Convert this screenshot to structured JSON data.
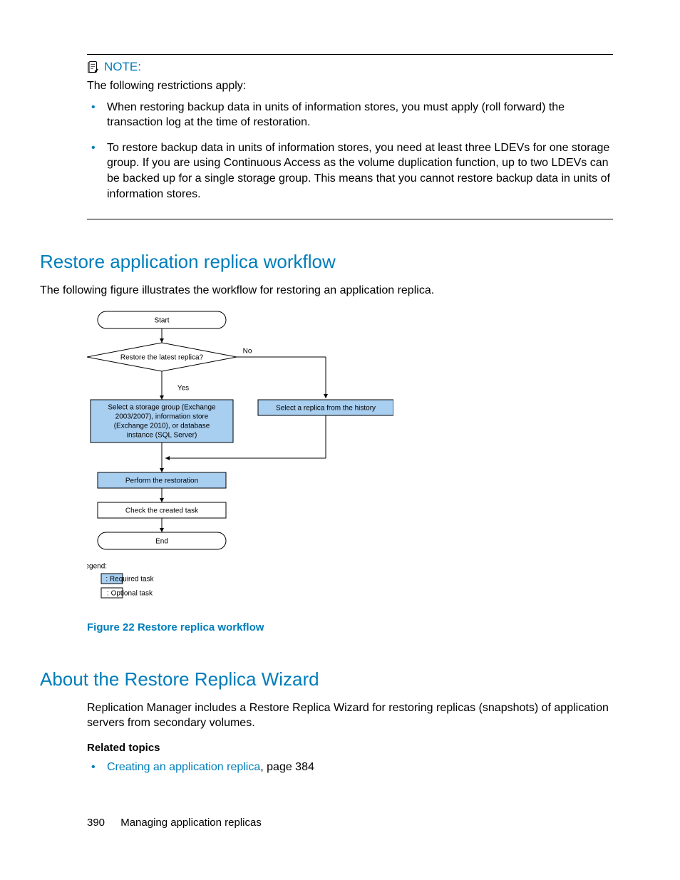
{
  "note": {
    "label": "NOTE:",
    "intro": "The following restrictions apply:",
    "bullets": [
      "When restoring backup data in units of information stores, you must apply (roll forward) the transaction log at the time of restoration.",
      "To restore backup data in units of information stores, you need at least three LDEVs for one storage group. If you are using Continuous Access as the volume duplication function, up to two LDEVs can be backed up for a single storage group. This means that you cannot restore backup data in units of information stores."
    ]
  },
  "section1": {
    "heading": "Restore application replica workflow",
    "intro": "The following figure illustrates the workflow for restoring an application replica.",
    "figure_caption": "Figure 22 Restore replica workflow"
  },
  "flowchart": {
    "start": "Start",
    "decision": "Restore the latest replica?",
    "no": "No",
    "yes": "Yes",
    "left_box": "Select a storage group (Exchange 2003/2007), information store (Exchange 2010), or database instance (SQL Server)",
    "left_lines": [
      "Select a storage group (Exchange",
      "2003/2007), information store",
      "(Exchange 2010), or database",
      "instance (SQL Server)"
    ],
    "right_box": "Select a replica from the history",
    "perform": "Perform the restoration",
    "check": "Check the created task",
    "end": "End",
    "legend_title": "Legend:",
    "legend_required": ": Required task",
    "legend_optional": ": Optional  task"
  },
  "section2": {
    "heading": "About the Restore Replica Wizard",
    "para": "Replication Manager includes a Restore Replica Wizard for restoring replicas (snapshots) of application servers from secondary volumes.",
    "related_heading": "Related topics",
    "related_link": "Creating an application replica",
    "related_suffix": ", page 384"
  },
  "footer": {
    "page_number": "390",
    "chapter": "Managing application replicas"
  }
}
